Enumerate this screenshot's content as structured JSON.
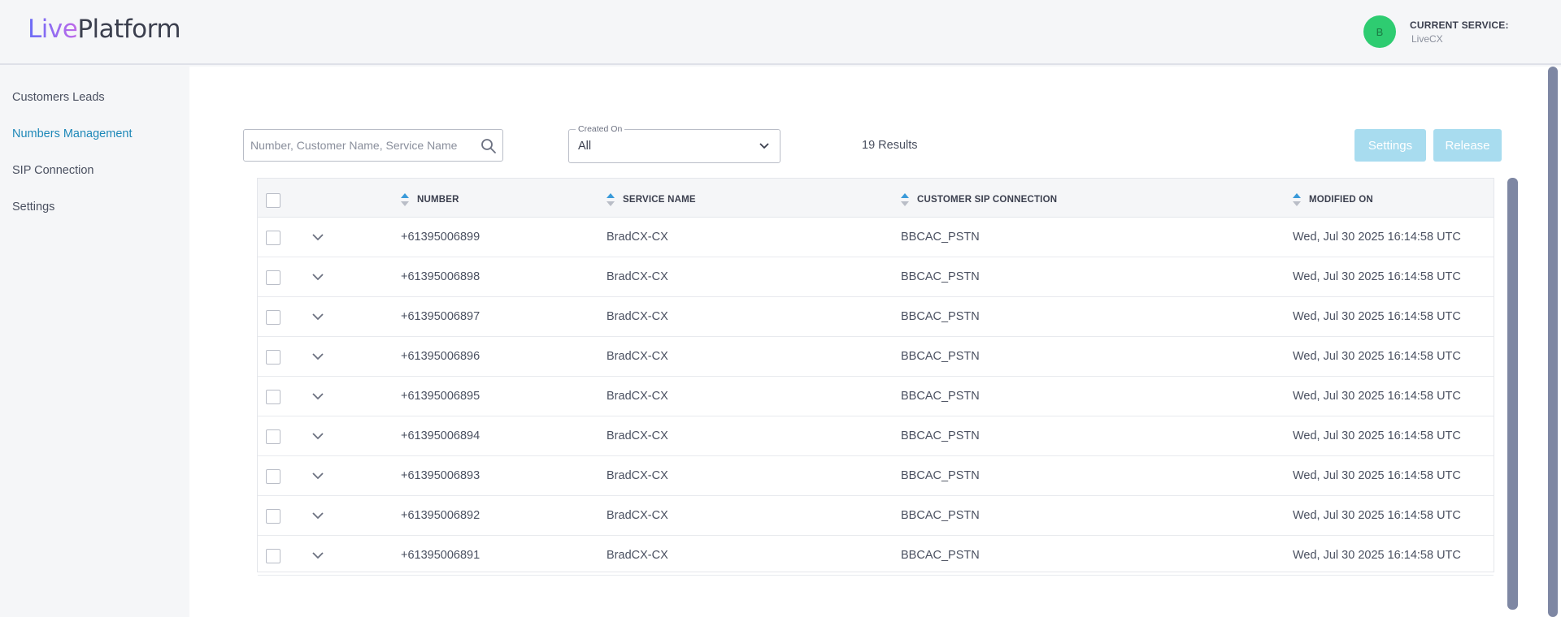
{
  "header": {
    "logo_live": "Live",
    "logo_platform": "Platform",
    "avatar_initial": "B",
    "current_service_label": "CURRENT SERVICE:",
    "current_service_value": "LiveCX"
  },
  "sidebar": {
    "items": [
      {
        "label": "Customers Leads",
        "active": false
      },
      {
        "label": "Numbers Management",
        "active": true
      },
      {
        "label": "SIP Connection",
        "active": false
      },
      {
        "label": "Settings",
        "active": false
      }
    ]
  },
  "toolbar": {
    "search_placeholder": "Number, Customer Name, Service Name",
    "filter_label": "Created On",
    "filter_value": "All",
    "results": "19 Results",
    "settings_label": "Settings",
    "release_label": "Release"
  },
  "table": {
    "columns": [
      "NUMBER",
      "SERVICE NAME",
      "CUSTOMER SIP CONNECTION",
      "MODIFIED ON"
    ],
    "rows": [
      {
        "number": "+61395006899",
        "service": "BradCX-CX",
        "sip": "BBCAC_PSTN",
        "modified": "Wed, Jul 30 2025 16:14:58 UTC"
      },
      {
        "number": "+61395006898",
        "service": "BradCX-CX",
        "sip": "BBCAC_PSTN",
        "modified": "Wed, Jul 30 2025 16:14:58 UTC"
      },
      {
        "number": "+61395006897",
        "service": "BradCX-CX",
        "sip": "BBCAC_PSTN",
        "modified": "Wed, Jul 30 2025 16:14:58 UTC"
      },
      {
        "number": "+61395006896",
        "service": "BradCX-CX",
        "sip": "BBCAC_PSTN",
        "modified": "Wed, Jul 30 2025 16:14:58 UTC"
      },
      {
        "number": "+61395006895",
        "service": "BradCX-CX",
        "sip": "BBCAC_PSTN",
        "modified": "Wed, Jul 30 2025 16:14:58 UTC"
      },
      {
        "number": "+61395006894",
        "service": "BradCX-CX",
        "sip": "BBCAC_PSTN",
        "modified": "Wed, Jul 30 2025 16:14:58 UTC"
      },
      {
        "number": "+61395006893",
        "service": "BradCX-CX",
        "sip": "BBCAC_PSTN",
        "modified": "Wed, Jul 30 2025 16:14:58 UTC"
      },
      {
        "number": "+61395006892",
        "service": "BradCX-CX",
        "sip": "BBCAC_PSTN",
        "modified": "Wed, Jul 30 2025 16:14:58 UTC"
      },
      {
        "number": "+61395006891",
        "service": "BradCX-CX",
        "sip": "BBCAC_PSTN",
        "modified": "Wed, Jul 30 2025 16:14:58 UTC"
      }
    ]
  },
  "colors": {
    "accent": "#1e88b8",
    "button_disabled": "#a8dcef",
    "avatar": "#2ecc71",
    "scrollbar": "#7e87a3",
    "sort_up": "#3a9ad9",
    "sort_down": "#b9bdc7"
  },
  "icons": {
    "search": "search-icon",
    "dropdown": "chevron-down-icon",
    "row_expand": "chevron-down-icon",
    "sort": "sort-icon"
  }
}
